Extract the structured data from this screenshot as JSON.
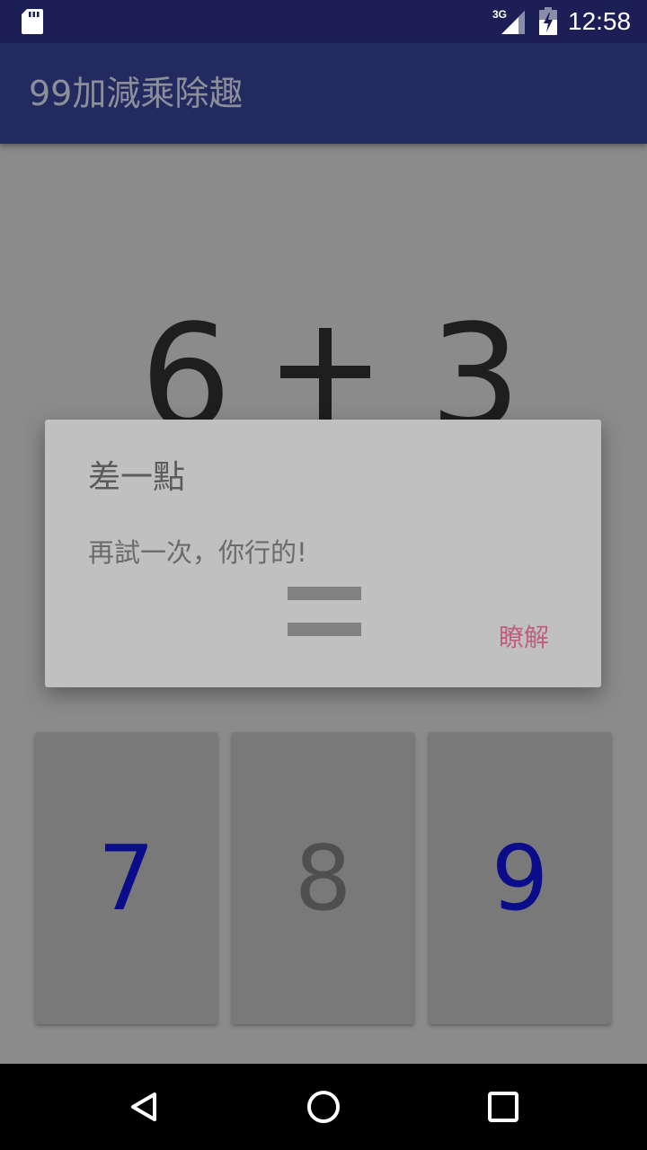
{
  "status_bar": {
    "network_label": "3G",
    "time": "12:58",
    "icons": [
      "sd-card-icon",
      "signal-icon",
      "battery-charging-icon"
    ]
  },
  "app_bar": {
    "title": "99加減乘除趣"
  },
  "equation": {
    "operand_a": "6",
    "operator_icon": "plus-icon",
    "operand_b": "3",
    "equals_icon": "equals-icon"
  },
  "dialog": {
    "title": "差一點",
    "message": "再試一次，你行的!",
    "confirm_label": "瞭解"
  },
  "choices": [
    {
      "label": "7",
      "color": "#0b0c8a"
    },
    {
      "label": "8",
      "color": "#4f4f4f"
    },
    {
      "label": "9",
      "color": "#0b0c8a"
    }
  ],
  "colors": {
    "status_bar": "#1b1f55",
    "app_bar": "#222a60",
    "scrim_background": "#8b8b8b",
    "dialog_background": "#c0c0c0",
    "accent_button": "#c05f7e"
  },
  "nav_bar": {
    "icons": [
      "back-icon",
      "home-icon",
      "recent-apps-icon"
    ]
  }
}
